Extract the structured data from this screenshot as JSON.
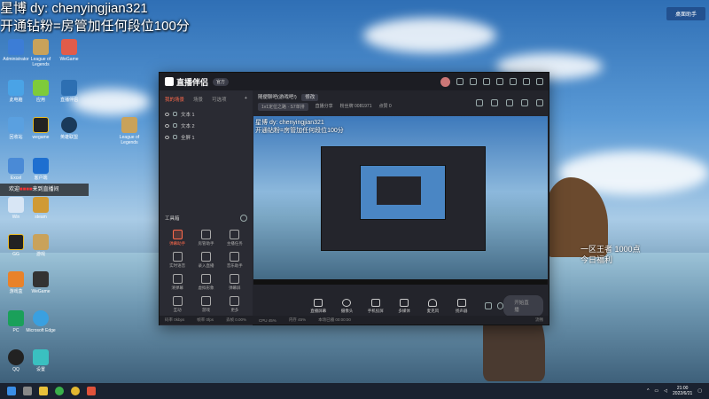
{
  "overlay": {
    "line1": "星博 dy: chenyingjian321",
    "line2": "开通钻粉=房管加任何段位100分"
  },
  "corner_note": "桌面助手",
  "welcome": {
    "prefix": "欢迎",
    "name": "■■■■",
    "suffix": "来到直播间"
  },
  "desktop_icons": [
    {
      "label": "Administrator"
    },
    {
      "label": "League of Legends"
    },
    {
      "label": "WeGame"
    },
    {
      "label": "此电脑"
    },
    {
      "label": "应用"
    },
    {
      "label": "直播伴侣"
    },
    {
      "label": "回收站"
    },
    {
      "label": "wegame"
    },
    {
      "label": "英雄联盟"
    },
    {
      "label": "League of Legends"
    },
    {
      "label": "Excel"
    },
    {
      "label": "客户端"
    },
    {
      "label": "Win"
    },
    {
      "label": "steam"
    },
    {
      "label": "GG"
    },
    {
      "label": "游戏"
    },
    {
      "label": "游戏盒"
    },
    {
      "label": "WeGame"
    },
    {
      "label": "PC"
    },
    {
      "label": "Microsoft Edge"
    },
    {
      "label": "QQ"
    },
    {
      "label": "设置"
    }
  ],
  "app": {
    "name": "直播伴侣",
    "version": "官方",
    "left_tabs": [
      "我的场景",
      "场景",
      "可选项"
    ],
    "sources": [
      "文本 1",
      "文本 2",
      "全屏 1"
    ],
    "tools_title": "工具箱",
    "tools": [
      {
        "label": "弹幕助手",
        "active": true
      },
      {
        "label": "房管助手",
        "active": false
      },
      {
        "label": "主播任务",
        "active": false
      },
      {
        "label": "实时语音",
        "active": false
      },
      {
        "label": "录入直播",
        "active": false
      },
      {
        "label": "音乐助手",
        "active": false
      },
      {
        "label": "清弹幕",
        "active": false
      },
      {
        "label": "虚拟形象",
        "active": false
      },
      {
        "label": "弹幕屏",
        "active": false
      },
      {
        "label": "互动",
        "active": false
      },
      {
        "label": "游戏",
        "active": false
      },
      {
        "label": "更多",
        "active": false
      }
    ],
    "stream_title": "随便聊吧(游戏吧!)",
    "stream_tag": "修改",
    "info_chips": [
      "1v1定位之路 · S7单排",
      "直播分享",
      "粉丝牌 0081971",
      "点赞 0"
    ],
    "preview_text1": "星博 dy: chenyingjian321",
    "preview_text2": "开通钻粉=房管加任何段位100分",
    "bottom_buttons": [
      "直播屏幕",
      "摄像头",
      "手机投屏",
      "多媒体",
      "麦克风",
      "扬声器"
    ],
    "start_label": "开始直播",
    "status_items": [
      "码率 0kbps",
      "帧率 0fps",
      "丢帧 0.00%",
      "CPU 45%",
      "内存 45%",
      "本场已播 00:00:00",
      "流畅"
    ]
  },
  "promo": {
    "line1": "一区王者 1000点",
    "line2": "今日福利"
  },
  "taskbar": {
    "time": "21:00",
    "date": "2022/6/21"
  },
  "colors": {
    "accent": "#ff6a4b",
    "app_bg": "#23242b"
  }
}
